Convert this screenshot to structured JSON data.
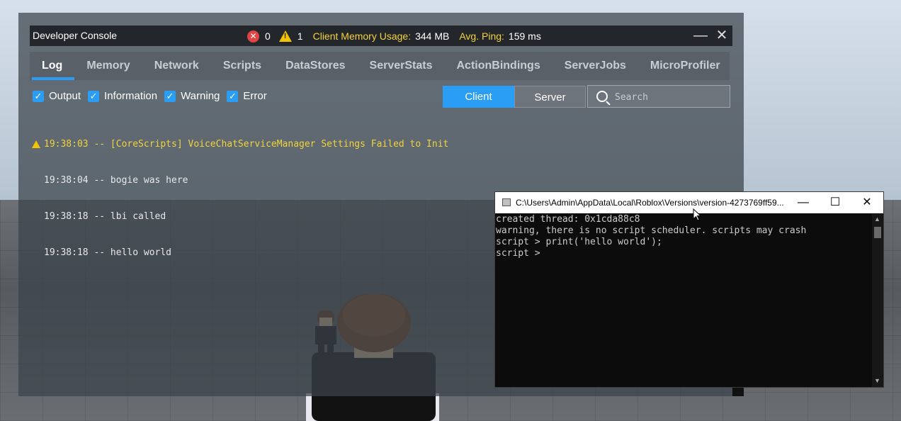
{
  "console": {
    "title": "Developer Console",
    "error_count": "0",
    "warning_count": "1",
    "memory_label": "Client Memory Usage:",
    "memory_value": "344 MB",
    "ping_label": "Avg. Ping:",
    "ping_value": "159 ms",
    "tabs": [
      "Log",
      "Memory",
      "Network",
      "Scripts",
      "DataStores",
      "ServerStats",
      "ActionBindings",
      "ServerJobs",
      "MicroProfiler"
    ],
    "active_tab": "Log",
    "filters": [
      "Output",
      "Information",
      "Warning",
      "Error"
    ],
    "segments": {
      "client": "Client",
      "server": "Server",
      "selected": "Client"
    },
    "search_placeholder": "Search",
    "log": [
      {
        "text": "19:38:03 -- [CoreScripts] VoiceChatServiceManager Settings Failed to Init",
        "level": "warning"
      },
      {
        "text": "19:38:04 -- bogie was here",
        "level": "output"
      },
      {
        "text": "19:38:18 -- lbi called",
        "level": "output"
      },
      {
        "text": "19:38:18 -- hello world",
        "level": "output"
      }
    ]
  },
  "cmd": {
    "title": "C:\\Users\\Admin\\AppData\\Local\\Roblox\\Versions\\version-4273769ff59...",
    "lines": [
      "created thread: 0x1cda88c8",
      "warning, there is no script scheduler. scripts may crash",
      "script > print('hello world');",
      "script > "
    ]
  },
  "colors": {
    "accent": "#2a9df4",
    "warning": "#f3d23a",
    "error": "#e04444"
  }
}
